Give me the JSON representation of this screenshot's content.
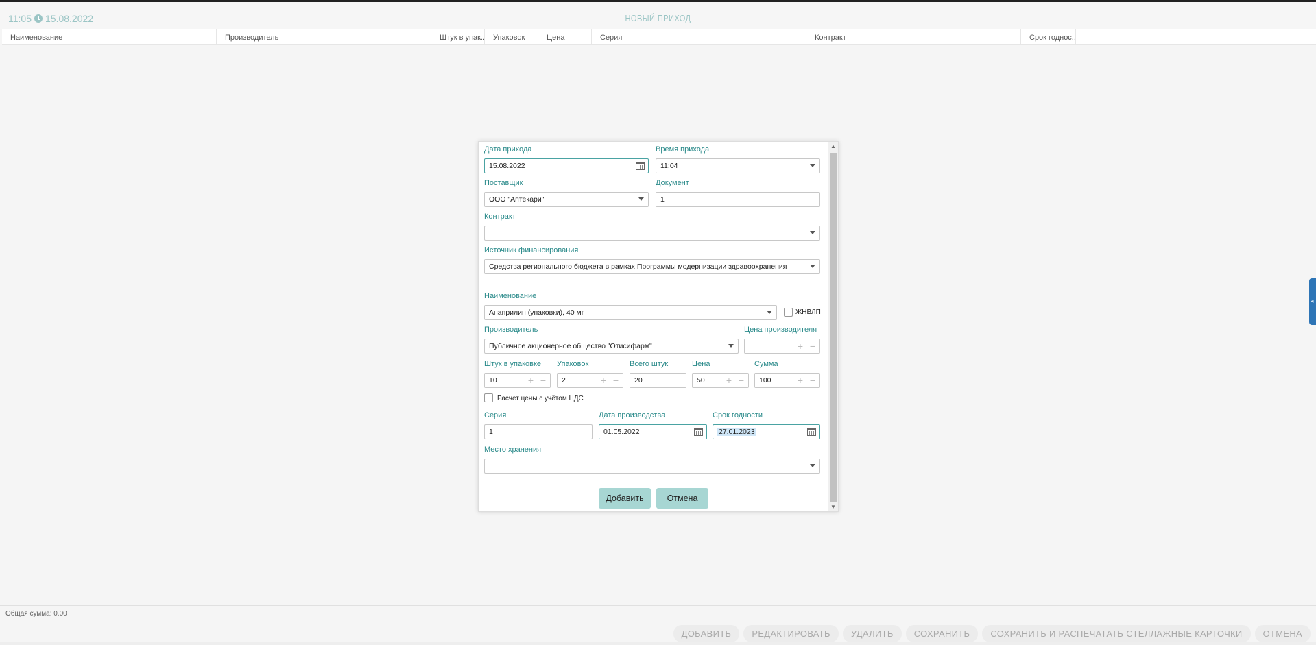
{
  "header": {
    "time": "11:05",
    "date": "15.08.2022",
    "title": "НОВЫЙ ПРИХОД"
  },
  "table": {
    "columns": [
      "Наименование",
      "Производитель",
      "Штук в упак...",
      "Упаковок",
      "Цена",
      "Серия",
      "Контракт",
      "Срок годнос..."
    ]
  },
  "modal": {
    "date_label": "Дата прихода",
    "date_value": "15.08.2022",
    "time_label": "Время прихода",
    "time_value": "11:04",
    "supplier_label": "Поставщик",
    "supplier_value": "ООО \"Аптекари\"",
    "document_label": "Документ",
    "document_value": "1",
    "contract_label": "Контракт",
    "contract_value": "",
    "funding_label": "Источник финансирования",
    "funding_value": "Средства регионального бюджета в рамках Программы модернизации здравоохранения",
    "name_label": "Наименование",
    "name_value": "Анаприлин (упаковки), 40 мг",
    "zhnvlp_label": "ЖНВЛП",
    "manufacturer_label": "Производитель",
    "manufacturer_value": "Публичное акционерное общество \"Отисифарм\"",
    "manufacturer_price_label": "Цена производителя",
    "manufacturer_price_value": "",
    "per_pack_label": "Штук в упаковке",
    "per_pack_value": "10",
    "packs_label": "Упаковок",
    "packs_value": "2",
    "total_label": "Всего штук",
    "total_value": "20",
    "price_label": "Цена",
    "price_value": "50",
    "sum_label": "Сумма",
    "sum_value": "100",
    "vat_label": "Расчет цены с учётом НДС",
    "series_label": "Серия",
    "series_value": "1",
    "prod_date_label": "Дата производства",
    "prod_date_value": "01.05.2022",
    "expiry_label": "Срок годности",
    "expiry_value": "27.01.2023",
    "storage_label": "Место хранения",
    "storage_value": "",
    "add_button": "Добавить",
    "cancel_button": "Отмена"
  },
  "footer": {
    "total_sum": "Общая сумма: 0.00"
  },
  "actions": [
    "ДОБАВИТЬ",
    "РЕДАКТИРОВАТЬ",
    "УДАЛИТЬ",
    "СОХРАНИТЬ",
    "СОХРАНИТЬ И РАСПЕЧАТАТЬ СТЕЛЛАЖНЫЕ КАРТОЧКИ",
    "ОТМЕНА"
  ],
  "colors": {
    "accent": "#2a8a8a",
    "header_text": "#9bc5c5",
    "button": "#a7d6d3",
    "side_handle": "#2e75b6"
  }
}
